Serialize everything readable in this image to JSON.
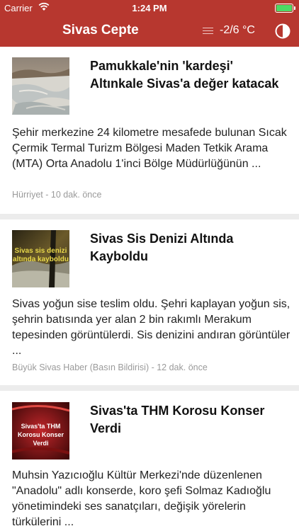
{
  "status_bar": {
    "carrier": "Carrier",
    "time": "1:24 PM"
  },
  "nav": {
    "title": "Sivas Cepte",
    "weather": "-2/6 °C",
    "icons": [
      "menu-icon",
      "theme-toggle-icon"
    ]
  },
  "articles": [
    {
      "headline": "Pamukkale'nin 'kardeşi' Altınkale Sivas'a değer katacak",
      "summary": "Şehir merkezine 24 kilometre mesafede bulunan Sıcak Çermik Termal Turizm Bölgesi Maden Tetkik Arama (MTA) Orta Anadolu 1'inci Bölge Müdürlüğünün ...",
      "meta": "Hürriyet - 10 dak. önce"
    },
    {
      "headline": "Sivas Sis Denizi Altında Kayboldu",
      "summary": "Sivas yoğun sise teslim oldu. Şehri kaplayan yoğun sis, şehrin batısında yer alan 2 bin rakımlı Merakum tepesinden görüntülerdi. Sis denizini andıran görüntüler ...",
      "meta": "Büyük Sivas Haber (Basın Bildirisi) - 12 dak. önce",
      "thumb_text": "Sivas sis denizi altında kayboldu"
    },
    {
      "headline": "Sivas'ta THM Korosu Konser Verdi",
      "summary": "Muhsin Yazıcıoğlu Kültür Merkezi'nde düzenlenen \"Anadolu\" adlı konserde, koro şefi Solmaz Kadıoğlu yönetimindeki ses sanatçıları, değişik yörelerin türkülerini ...",
      "thumb_text": "Sivas'ta THM Korosu Konser Verdi"
    }
  ]
}
